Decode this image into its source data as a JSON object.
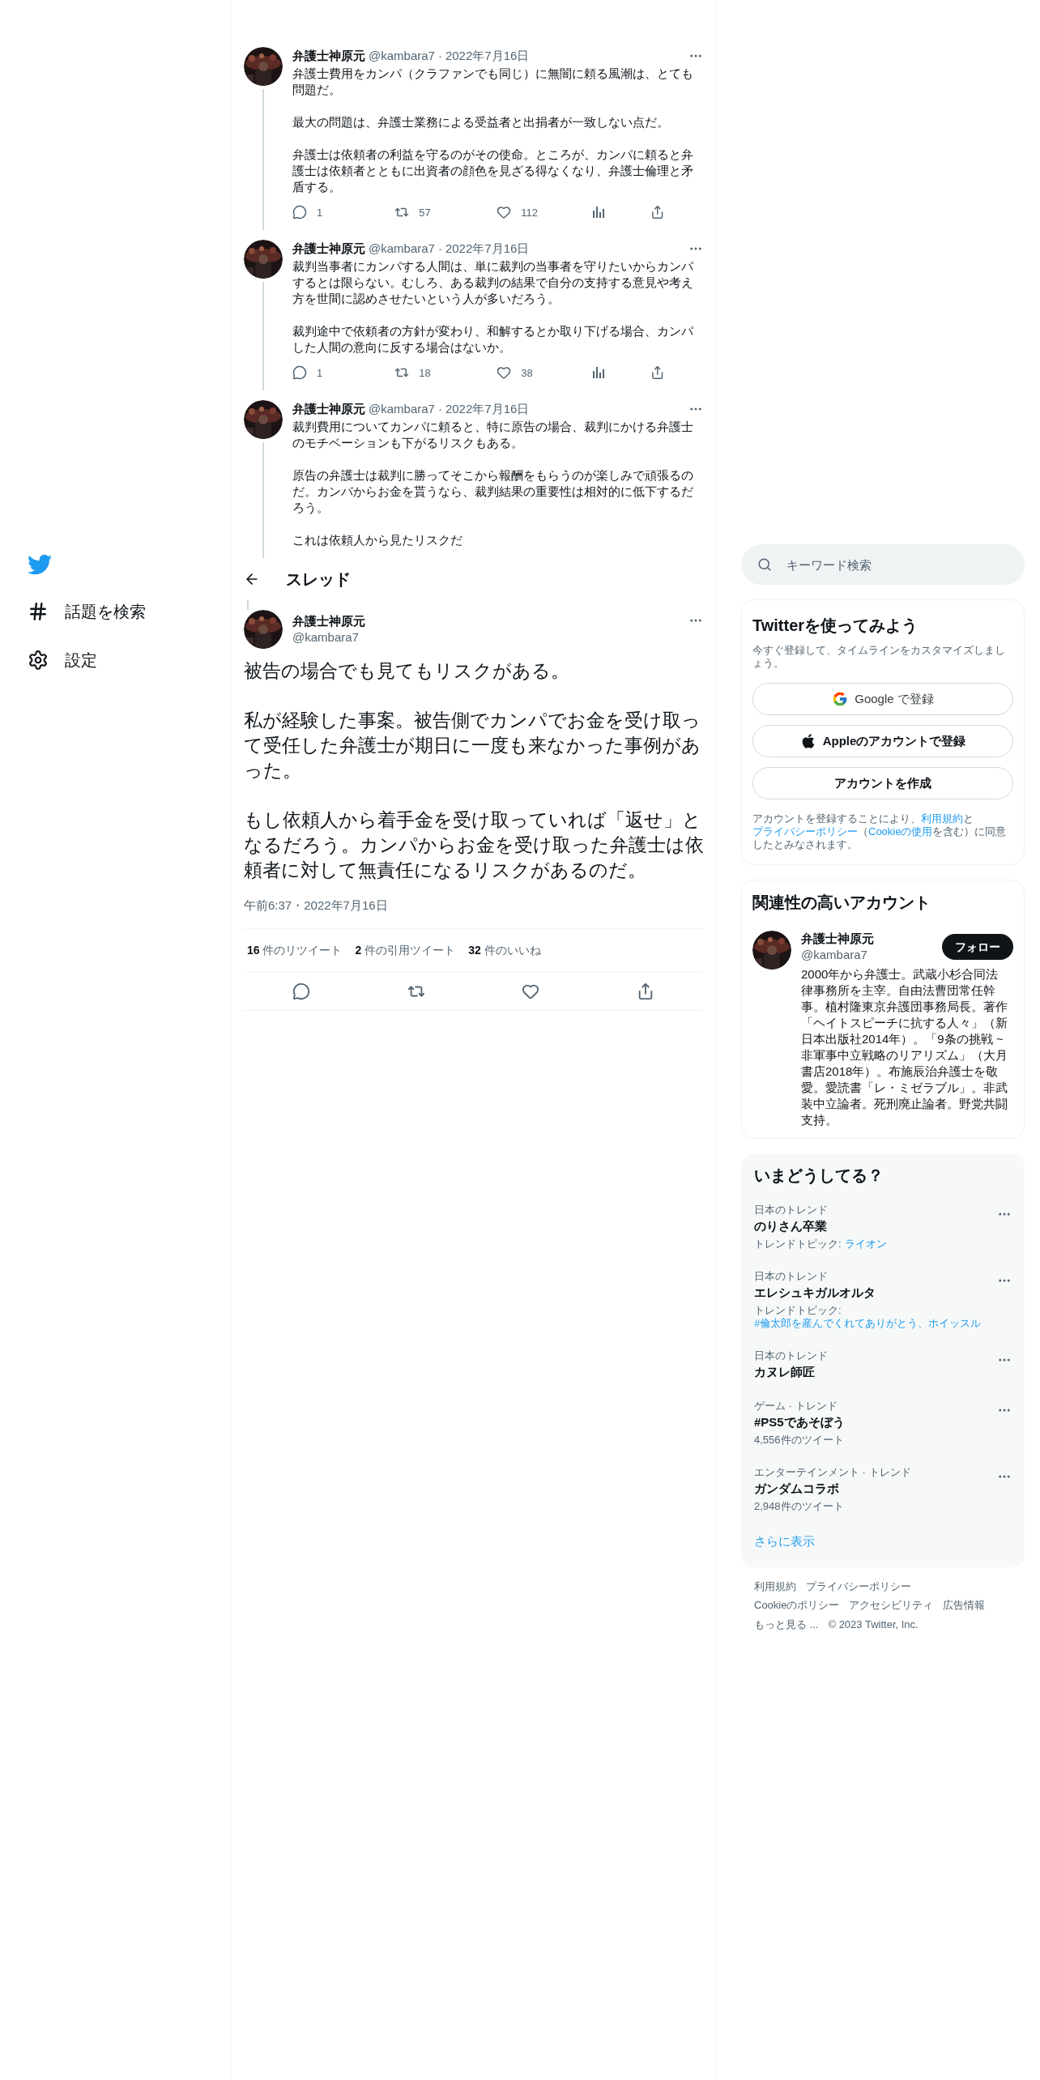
{
  "nav": {
    "items": [
      {
        "label": "話題を検索",
        "kind": "hashtag"
      },
      {
        "label": "設定",
        "kind": "settings"
      }
    ]
  },
  "thread": [
    {
      "name": "弁護士神原元",
      "handle": "@kambara7",
      "separator": "·",
      "date": "2022年7月16日",
      "paragraphs": [
        "弁護士費用をカンパ（クラファンでも同じ）に無闇に頼る風潮は、とても問題だ。",
        "最大の問題は、弁護士業務による受益者と出捐者が一致しない点だ。",
        "弁護士は依頼者の利益を守るのがその使命。ところが、カンパに頼ると弁護士は依頼者とともに出資者の顔色を見ざる得なくなり、弁護士倫理と矛盾する。"
      ],
      "replies": "1",
      "retweets": "57",
      "likes": "112"
    },
    {
      "name": "弁護士神原元",
      "handle": "@kambara7",
      "separator": "·",
      "date": "2022年7月16日",
      "paragraphs": [
        "裁判当事者にカンパする人間は、単に裁判の当事者を守りたいからカンパするとは限らない。むしろ、ある裁判の結果で自分の支持する意見や考え方を世間に認めさせたいという人が多いだろう。",
        "裁判途中で依頼者の方針が変わり、和解するとか取り下げる場合、カンパした人間の意向に反する場合はないか。"
      ],
      "replies": "1",
      "retweets": "18",
      "likes": "38"
    },
    {
      "name": "弁護士神原元",
      "handle": "@kambara7",
      "separator": "·",
      "date": "2022年7月16日",
      "paragraphs": [
        "裁判費用についてカンパに頼ると、特に原告の場合、裁判にかける弁護士のモチベーションも下がるリスクもある。",
        "原告の弁護士は裁判に勝ってそこから報酬をもらうのが楽しみで頑張るのだ。カンパからお金を貰うなら、裁判結果の重要性は相対的に低下するだろう。",
        "これは依頼人から見たリスクだ"
      ]
    }
  ],
  "header": {
    "title": "スレッド"
  },
  "main_tweet": {
    "name": "弁護士神原元",
    "handle": "@kambara7",
    "paragraphs": [
      "被告の場合でも見てもリスクがある。",
      "私が経験した事案。被告側でカンパでお金を受け取って受任した弁護士が期日に一度も来なかった事例があった。",
      "もし依頼人から着手金を受け取っていれば「返せ」となるだろう。カンパからお金を受け取った弁護士は依頼者に対して無責任になるリスクがあるのだ。"
    ],
    "timestamp": "午前6:37・2022年7月16日",
    "stats": [
      {
        "count": "16",
        "label": "件のリツイート"
      },
      {
        "count": "2",
        "label": "件の引用ツイート"
      },
      {
        "count": "32",
        "label": "件のいいね"
      }
    ]
  },
  "search": {
    "placeholder": "キーワード検索"
  },
  "signup": {
    "title": "Twitterを使ってみよう",
    "subtitle": "今すぐ登録して、タイムラインをカスタマイズしましょう。",
    "buttons": [
      {
        "label": "Google で登録",
        "kind": "google"
      },
      {
        "label": "Appleのアカウントで登録",
        "kind": "apple"
      },
      {
        "label": "アカウントを作成",
        "kind": "create"
      }
    ],
    "legal": [
      {
        "text": "アカウントを登録することにより、",
        "link": false
      },
      {
        "text": "利用規約",
        "link": true
      },
      {
        "text": "と",
        "link": false
      },
      {
        "text": "プライバシーポリシー",
        "link": true
      },
      {
        "text": "（",
        "link": false
      },
      {
        "text": "Cookieの使用",
        "link": true
      },
      {
        "text": "を含む）に同意したとみなされます。",
        "link": false
      }
    ]
  },
  "related": {
    "title": "関連性の高いアカウント",
    "accounts": [
      {
        "name": "弁護士神原元",
        "handle": "@kambara7",
        "button": "フォロー",
        "bio": "2000年から弁護士。武蔵小杉合同法律事務所を主宰。自由法曹団常任幹事。植村隆東京弁護団事務局長。著作「ヘイトスピーチに抗する人々」（新日本出版社2014年）。「9条の挑戦 ~非軍事中立戦略のリアリズム」（大月書店2018年）。布施辰治弁護士を敬愛。愛読書「レ・ミゼラブル」。非武装中立論者。死刑廃止論者。野党共闘支持。"
      }
    ]
  },
  "trends": {
    "title": "いまどうしてる？",
    "items": [
      {
        "context": "日本のトレンド",
        "name": "のりさん卒業",
        "topic_label": "トレンドトピック:",
        "topics": "ライオン"
      },
      {
        "context": "日本のトレンド",
        "name": "エレシュキガルオルタ",
        "topic_label": "トレンドトピック:",
        "topics": "#倫太郎を産んでくれてありがとう、ホイッスル"
      },
      {
        "context": "日本のトレンド",
        "name": "カヌレ師匠"
      },
      {
        "context": "ゲーム · トレンド",
        "name": "#PS5であそぼう",
        "count": "4,556件のツイート"
      },
      {
        "context": "エンターテインメント · トレンド",
        "name": "ガンダムコラボ",
        "count": "2,948件のツイート"
      }
    ],
    "more": "さらに表示"
  },
  "footer": {
    "links": [
      "利用規約",
      "プライバシーポリシー",
      "Cookieのポリシー",
      "アクセシビリティ",
      "広告情報",
      "もっと見る ..."
    ],
    "copyright": "© 2023 Twitter, Inc."
  }
}
